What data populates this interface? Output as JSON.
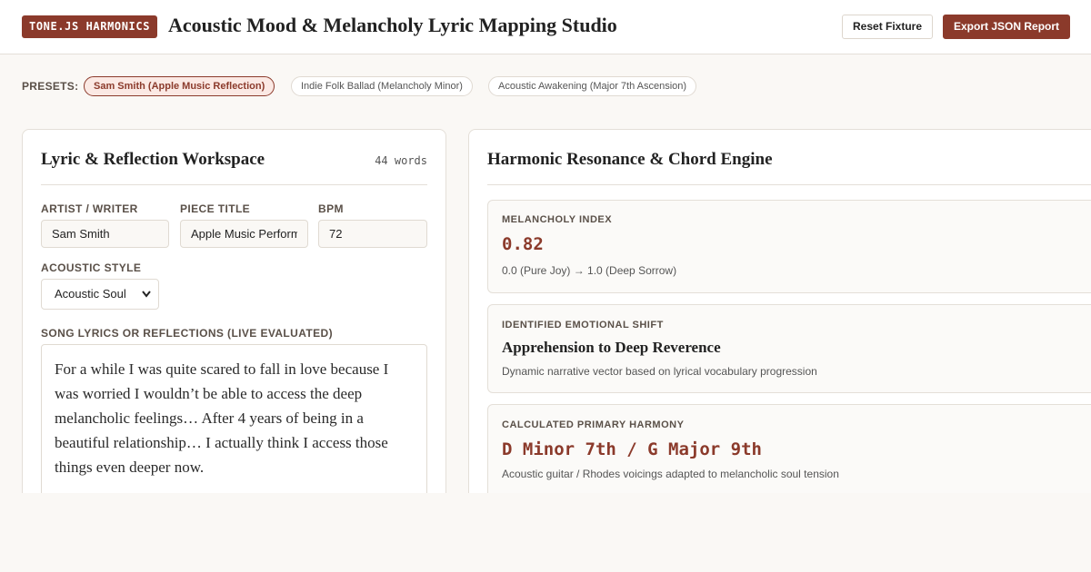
{
  "header": {
    "badge": "TONE.JS HARMONICS",
    "title": "Acoustic Mood & Melancholy Lyric Mapping Studio",
    "reset_label": "Reset Fixture",
    "export_label": "Export JSON Report"
  },
  "presets": {
    "label": "PRESETS:",
    "items": [
      {
        "label": "Sam Smith (Apple Music Reflection)",
        "active": true
      },
      {
        "label": "Indie Folk Ballad (Melancholy Minor)",
        "active": false
      },
      {
        "label": "Acoustic Awakening (Major 7th Ascension)",
        "active": false
      }
    ]
  },
  "workspace": {
    "title": "Lyric & Reflection Workspace",
    "word_count": "44 words",
    "artist_label": "ARTIST / WRITER",
    "artist_value": "Sam Smith",
    "piece_label": "PIECE TITLE",
    "piece_value": "Apple Music Performance",
    "bpm_label": "BPM",
    "bpm_value": "72",
    "style_label": "ACOUSTIC STYLE",
    "style_value": "Acoustic Soul",
    "lyrics_label": "SONG LYRICS OR REFLECTIONS (LIVE EVALUATED)",
    "lyrics_text": "For a while I was quite scared to fall in love because I was worried I wouldn’t be able to access the deep melancholic feelings… After 4 years of being in a beautiful relationship… I actually think I access those things even deeper now."
  },
  "engine": {
    "title": "Harmonic Resonance & Chord Engine",
    "melancholy": {
      "label": "MELANCHOLY INDEX",
      "value": "0.82",
      "scale": "0.0 (Pure Joy) → 1.0 (Deep Sorrow)"
    },
    "shift": {
      "label": "IDENTIFIED EMOTIONAL SHIFT",
      "value": "Apprehension to Deep Reverence",
      "description": "Dynamic narrative vector based on lyrical vocabulary progression"
    },
    "harmony": {
      "label": "CALCULATED PRIMARY HARMONY",
      "value": "D Minor 7th / G Major 9th",
      "description": "Acoustic guitar / Rhodes voicings adapted to melancholic soul tension"
    }
  }
}
